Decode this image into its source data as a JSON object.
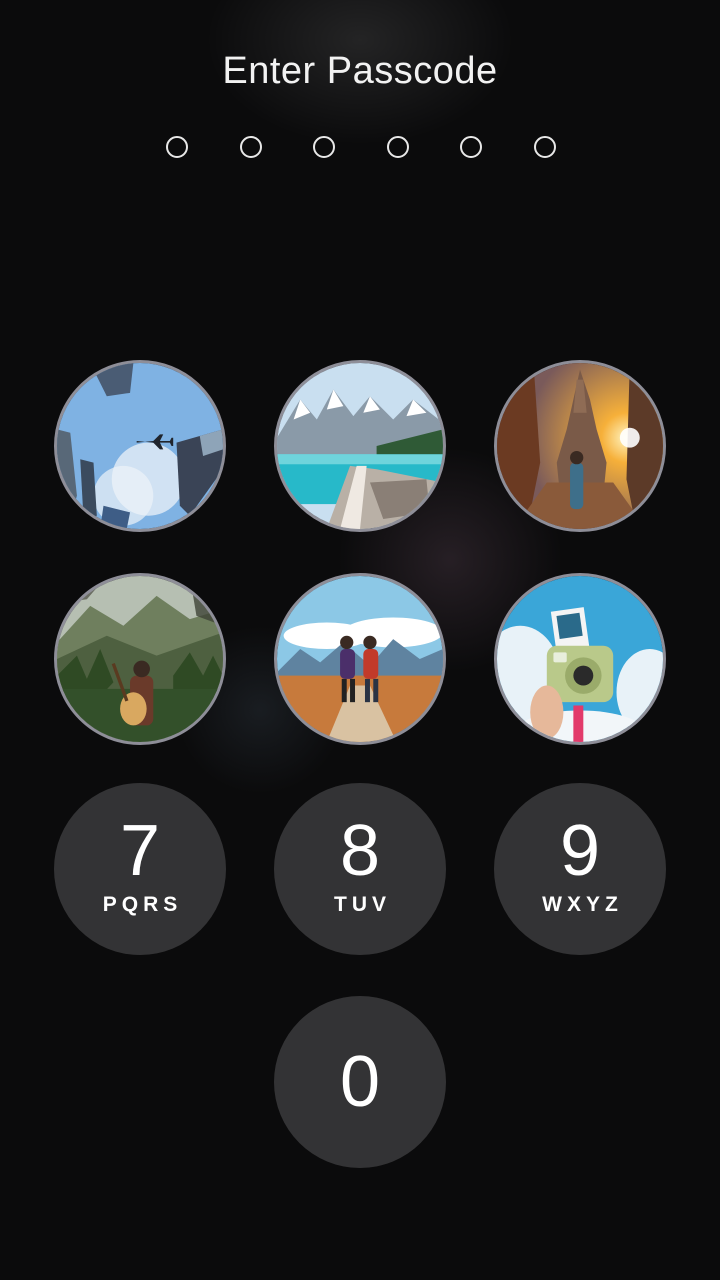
{
  "header": {
    "title": "Enter Passcode",
    "passcode_length": 6,
    "entered_count": 0
  },
  "keypad": {
    "photo_keys": [
      {
        "name": "photo-key-1",
        "icon": "skyscrapers-airplane-photo"
      },
      {
        "name": "photo-key-2",
        "icon": "mountain-lake-photo"
      },
      {
        "name": "photo-key-3",
        "icon": "temple-sunset-photo"
      },
      {
        "name": "photo-key-4",
        "icon": "forest-guitarist-photo"
      },
      {
        "name": "photo-key-5",
        "icon": "hikers-mountains-photo"
      },
      {
        "name": "photo-key-6",
        "icon": "instant-camera-photo"
      }
    ],
    "key7": {
      "digit": "7",
      "letters": "PQRS"
    },
    "key8": {
      "digit": "8",
      "letters": "TUV"
    },
    "key9": {
      "digit": "9",
      "letters": "WXYZ"
    },
    "key0": {
      "digit": "0"
    }
  },
  "colors": {
    "background": "#0b0b0c",
    "key_fill": "#555558",
    "photo_border": "#8e8e98",
    "text": "#ffffff"
  }
}
